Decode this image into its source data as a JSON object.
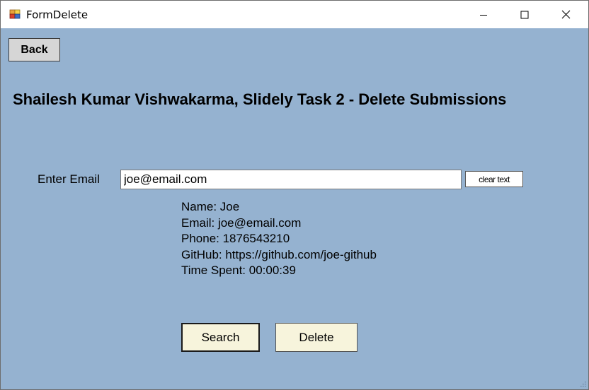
{
  "window": {
    "title": "FormDelete",
    "app_icon": "form-app-icon",
    "controls": [
      "minimize-icon",
      "maximize-icon",
      "close-icon"
    ]
  },
  "toolbar": {
    "back_label": "Back"
  },
  "header": {
    "title": "Shailesh Kumar Vishwakarma, Slidely Task 2 - Delete Submissions"
  },
  "form": {
    "email_label": "Enter Email",
    "email_value": "joe@email.com",
    "clear_label": "clear text"
  },
  "details": {
    "name": "Name: Joe",
    "email": "Email: joe@email.com",
    "phone": "Phone: 1876543210",
    "github": "GitHub: https://github.com/joe-github",
    "time_spent": "Time Spent: 00:00:39"
  },
  "actions": {
    "search_label": "Search",
    "delete_label": "Delete"
  },
  "colors": {
    "client_bg": "#95b2d0",
    "action_button_bg": "#f7f4dc",
    "back_button_bg": "#d6d6d6"
  }
}
